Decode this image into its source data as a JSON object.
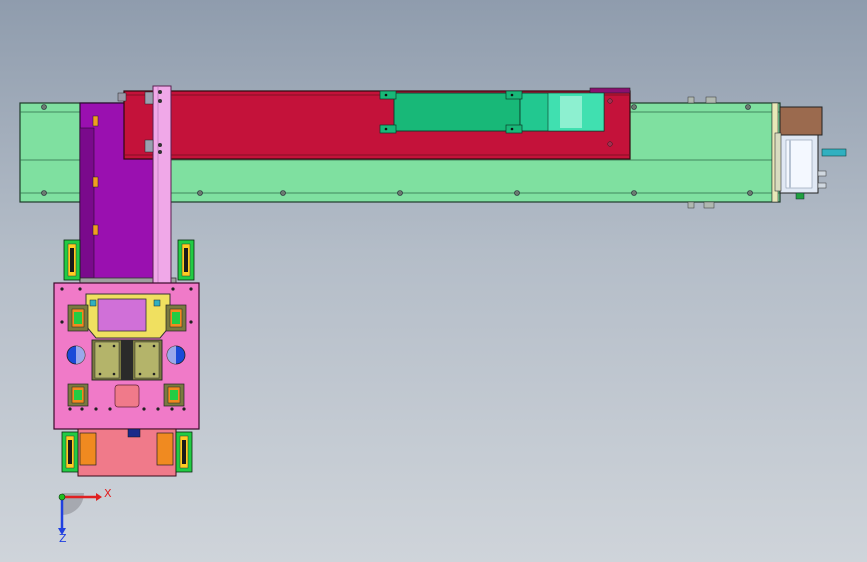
{
  "viewport": {
    "background_top": "#8f9cad",
    "background_bottom": "#cfd4da"
  },
  "model": {
    "colors": {
      "rail": "#7fe0a0",
      "carriage": "#c4123a",
      "carriage_slot": "#18b878",
      "belt_cover": "#22c890",
      "motor_housing": "#9b6a4e",
      "motor_body": "#e0e8f4",
      "vertical_column": "#9a10b0",
      "pink_bar": "#f0a8e8",
      "base_plate": "#f07ac8",
      "clamp_block": "#7a7a40",
      "gripper_frame": "#f0e060",
      "gripper_window": "#d070d8",
      "hole_blue": "#1a4ad8",
      "wheel_green": "#22cc44",
      "foot_orange": "#f08a20",
      "foot_pink": "#f07a8a"
    }
  },
  "triad": {
    "x_label": "X",
    "z_label": "Z",
    "x_color": "#e02020",
    "z_color": "#2040e0"
  }
}
